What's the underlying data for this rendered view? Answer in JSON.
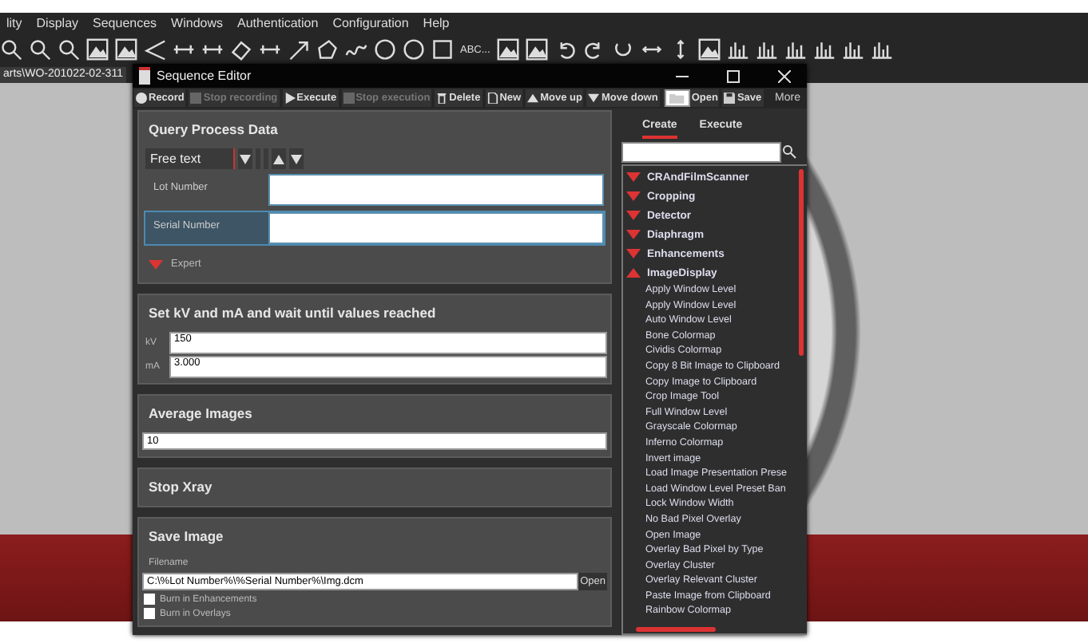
{
  "app": {
    "menu": [
      "lity",
      "Display",
      "Sequences",
      "Windows",
      "Authentication",
      "Configuration",
      "Help"
    ],
    "text_tool": "ABC...",
    "path_tab": "arts\\WO-201022-02-311"
  },
  "editor": {
    "title": "Sequence Editor",
    "actions": [
      {
        "kind": "record",
        "label": "Record",
        "disabled": false
      },
      {
        "kind": "stop",
        "label": "Stop recording",
        "disabled": true
      },
      {
        "kind": "play",
        "label": "Execute",
        "disabled": false
      },
      {
        "kind": "stop",
        "label": "Stop execution",
        "disabled": true
      },
      {
        "kind": "trash",
        "label": "Delete",
        "disabled": false
      },
      {
        "kind": "page",
        "label": "New",
        "disabled": false
      },
      {
        "kind": "up",
        "label": "Move up",
        "disabled": false
      },
      {
        "kind": "down",
        "label": "Move down",
        "disabled": false
      },
      {
        "kind": "folder",
        "label": "Open",
        "disabled": false
      },
      {
        "kind": "disk",
        "label": "Save",
        "disabled": false
      }
    ],
    "more": "More",
    "steps": [
      {
        "kind": "query",
        "title": "Query Process Data",
        "selector": "Free text",
        "fields": [
          {
            "label": "Lot Number",
            "selected": false
          },
          {
            "label": "Serial Number",
            "selected": true
          }
        ],
        "expert": "Expert"
      },
      {
        "kind": "xray",
        "title": "Set kV and mA and wait until values reached",
        "fields": [
          {
            "label": "kV",
            "value": "150"
          },
          {
            "label": "mA",
            "value": "3.000"
          }
        ]
      },
      {
        "kind": "average",
        "title": "Average Images",
        "value": "10"
      },
      {
        "kind": "stop",
        "title": "Stop Xray"
      },
      {
        "kind": "save",
        "title": "Save Image",
        "field_label": "Filename",
        "value": "C:\\%Lot Number%\\%Serial Number%\\Img.dcm",
        "open": "Open",
        "options": [
          {
            "label": "Burn in Enhancements",
            "checked": false
          },
          {
            "label": "Burn in Overlays",
            "checked": false
          }
        ]
      }
    ],
    "palette": {
      "tabs": [
        {
          "label": "Create",
          "selected": true
        },
        {
          "label": "Execute",
          "selected": false
        }
      ],
      "groups": [
        {
          "label": "CRAndFilmScanner",
          "expanded": false
        },
        {
          "label": "Cropping",
          "expanded": false
        },
        {
          "label": "Detector",
          "expanded": false
        },
        {
          "label": "Diaphragm",
          "expanded": false
        },
        {
          "label": "Enhancements",
          "expanded": false
        },
        {
          "label": "ImageDisplay",
          "expanded": true,
          "children": [
            "Apply Window Level",
            "Apply Window Level",
            "Auto Window Level",
            "Bone Colormap",
            "Cividis Colormap",
            "Copy 8 Bit Image to Clipboard",
            "Copy Image to Clipboard",
            "Crop Image Tool",
            "Full Window Level",
            "Grayscale Colormap",
            "Inferno Colormap",
            "Invert image",
            "Load Image Presentation Prese",
            "Load Window Level Preset Ban",
            "Lock Window Width",
            "No Bad Pixel Overlay",
            "Open Image",
            "Overlay Bad Pixel by Type",
            "Overlay Cluster",
            "Overlay Relevant Cluster",
            "Paste Image from Clipboard",
            "Rainbow Colormap"
          ]
        }
      ]
    }
  }
}
